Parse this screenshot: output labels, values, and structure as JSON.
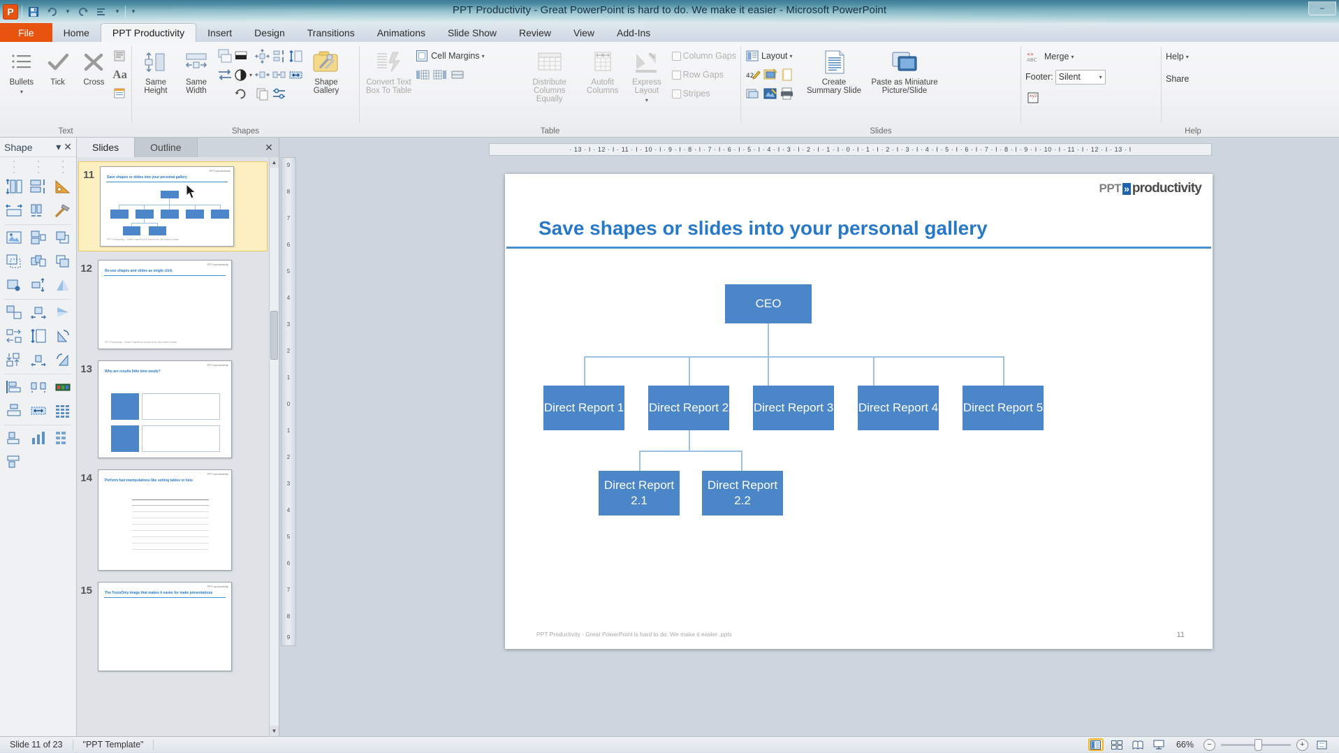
{
  "window": {
    "title": "PPT Productivity - Great PowerPoint is hard to do. We make it easier  -  Microsoft PowerPoint",
    "minimize": "–",
    "maximize": "❐",
    "close": "✕"
  },
  "quick_access": {
    "app_letter": "P",
    "items": [
      {
        "name": "save-icon",
        "glyph": "💾"
      },
      {
        "name": "undo-icon",
        "glyph": "↶"
      },
      {
        "name": "redo-icon",
        "glyph": "↻"
      },
      {
        "name": "align-icon",
        "glyph": "≡"
      },
      {
        "name": "customize-qat-icon",
        "glyph": "▾"
      }
    ]
  },
  "tabs": [
    {
      "label": "File",
      "active": false,
      "file": true
    },
    {
      "label": "Home",
      "active": false
    },
    {
      "label": "PPT Productivity",
      "active": true
    },
    {
      "label": "Insert",
      "active": false
    },
    {
      "label": "Design",
      "active": false
    },
    {
      "label": "Transitions",
      "active": false
    },
    {
      "label": "Animations",
      "active": false
    },
    {
      "label": "Slide Show",
      "active": false
    },
    {
      "label": "Review",
      "active": false
    },
    {
      "label": "View",
      "active": false
    },
    {
      "label": "Add-Ins",
      "active": false
    }
  ],
  "ribbon": {
    "groups": [
      {
        "label": "Text",
        "big_buttons": [
          {
            "label": "Bullets",
            "icon": "bullets-icon",
            "dropdown": true
          },
          {
            "label": "Tick",
            "icon": "tick-icon"
          },
          {
            "label": "Cross",
            "icon": "cross-icon"
          }
        ],
        "small_buttons": [
          {
            "icon": "text-paragraph-icon"
          },
          {
            "icon": "font-aa-icon",
            "glyph": "Aa"
          },
          {
            "icon": "text-box-icon"
          }
        ]
      },
      {
        "label": "Shapes",
        "big_buttons": [
          {
            "label": "Same Height",
            "icon": "same-height-icon"
          },
          {
            "label": "Same Width",
            "icon": "same-width-icon"
          },
          {
            "label": "Shape Gallery",
            "icon": "shape-gallery-icon"
          }
        ],
        "small_buttons": [
          {
            "icon": "align-distribute-horizontal-icon"
          },
          {
            "icon": "align-distribute-vertical-icon"
          },
          {
            "icon": "resize-height-icon"
          },
          {
            "icon": "spread-horizontal-icon"
          },
          {
            "icon": "spread-vertical-icon"
          },
          {
            "icon": "fit-width-icon"
          },
          {
            "icon": "fill-color-icon"
          },
          {
            "icon": "contrast-icon"
          },
          {
            "icon": "rotate-icon"
          },
          {
            "icon": "copy-format-icon"
          },
          {
            "icon": "swap-icon"
          }
        ]
      },
      {
        "label": "Table",
        "big_buttons": [
          {
            "label": "Convert Text Box To Table",
            "icon": "convert-text-to-table-icon",
            "disabled": true
          },
          {
            "label": "Distribute Columns Equally",
            "icon": "distribute-columns-icon",
            "disabled": true
          },
          {
            "label": "Autofit Columns",
            "icon": "autofit-columns-icon",
            "disabled": true
          },
          {
            "label": "Express Layout",
            "icon": "express-layout-icon",
            "disabled": true,
            "dropdown": true
          }
        ],
        "cell_margins_label": "Cell Margins",
        "small_buttons": [
          {
            "icon": "insert-column-left-icon"
          },
          {
            "icon": "insert-column-right-icon"
          },
          {
            "icon": "merge-cells-icon"
          }
        ],
        "checkboxes": [
          {
            "label": "Column Gaps",
            "checked": false
          },
          {
            "label": "Row Gaps",
            "checked": false
          },
          {
            "label": "Stripes",
            "checked": false
          }
        ]
      },
      {
        "label": "Slides",
        "layout_label": "Layout",
        "big_buttons": [
          {
            "label": "Create Summary Slide",
            "icon": "create-summary-slide-icon"
          },
          {
            "label": "Paste as Miniature Picture/Slide",
            "icon": "paste-miniature-icon"
          }
        ],
        "small_buttons": [
          {
            "icon": "rename-slide-icon"
          },
          {
            "icon": "slide-properties-icon"
          },
          {
            "icon": "blank-slide-icon"
          },
          {
            "icon": "slide-export-icon"
          },
          {
            "icon": "slide-image-icon"
          },
          {
            "icon": "print-icon"
          }
        ]
      },
      {
        "label": "Help",
        "merge_label": "Merge",
        "footer_label": "Footer:",
        "footer_value": "Silent",
        "help_label": "Help",
        "share_label": "Share",
        "xyz_icon": "xyz-note-icon"
      }
    ]
  },
  "shape_pane": {
    "title": "Shape",
    "close": "✕",
    "dropdown": "▾",
    "icons": [
      "same-height-icon",
      "align-middle-icon",
      "triangle-ruler-icon",
      "same-width-icon",
      "distribute-horizontal-icon",
      "hammer-icon",
      "insert-picture-icon",
      "duplicate-shape-icon",
      "bring-forward-icon",
      "select-shape-icon",
      "group-shapes-icon",
      "send-backward-icon",
      "picture-fill-icon",
      "spread-vertical-icon",
      "flip-vertical-icon",
      "swap-shapes-icon",
      "spread-horizontal-icon",
      "flip-horizontal-icon",
      "move-right-icon",
      "resize-height-icon",
      "rotate-left-icon",
      "move-down-icon",
      "shrink-horizontal-icon",
      "rotate-right-icon",
      "align-left-icon",
      "expand-horizontal-icon",
      "color-palette-icon",
      "align-center-icon",
      "fit-width-icon",
      "table-grid-icon",
      "align-bottom-icon",
      "chart-icon",
      "matrix-icon",
      "align-top-icon",
      "bar-chart-icon",
      "grid-icon"
    ]
  },
  "slides_pane": {
    "tabs": [
      {
        "label": "Slides",
        "active": true
      },
      {
        "label": "Outline",
        "active": false
      }
    ],
    "close": "✕",
    "thumbnails": [
      {
        "number": "11",
        "title": "Save shapes or slides into your personal gallery",
        "selected": true,
        "type": "orgchart",
        "footer": "PPT Productivity - Great PowerPoint is hard to do. We make it easier"
      },
      {
        "number": "12",
        "title": "Re-use shapes and slides as single click",
        "selected": false,
        "type": "blank",
        "footer": "PPT Productivity - Great PowerPoint is hard to do. We make it easier"
      },
      {
        "number": "13",
        "title": "Who are results little time needs?",
        "selected": false,
        "type": "twobox",
        "footer": ""
      },
      {
        "number": "14",
        "title": "Perform fast manipulations like setting tables or lists",
        "selected": false,
        "type": "table",
        "footer": ""
      },
      {
        "number": "15",
        "title": "The ToolsOnly image that makes it easier for make presentations",
        "selected": false,
        "type": "blank",
        "footer": ""
      }
    ]
  },
  "ruler": {
    "horizontal": "· 13 · I · 12 · I · 11 · I · 10 · I · 9 · I · 8 · I · 7 · I · 6 · I · 5 · I · 4 · I · 3 · I · 2 · I · 1 · I · 0 · I · 1 · I · 2 · I · 3 · I · 4 · I · 5 · I · 6 · I · 7 · I · 8 · I · 9 · I · 10 · I · 11 · I · 12 · I · 13 · I",
    "vertical_ticks": [
      "9",
      "8",
      "7",
      "6",
      "5",
      "4",
      "3",
      "2",
      "1",
      "0",
      "1",
      "2",
      "3",
      "4",
      "5",
      "6",
      "7",
      "8",
      "9"
    ]
  },
  "slide": {
    "logo": {
      "ppt": "PPT",
      "chevron": "»",
      "productivity": "productivity"
    },
    "title": "Save shapes or slides into your personal gallery",
    "footer": "PPT Productivity - Great PowerPoint  is hard  to do. We make it easier .pptx",
    "number": "11",
    "chart_data": {
      "type": "orgchart",
      "title": "Save shapes or slides into your personal gallery",
      "nodes": [
        {
          "id": "ceo",
          "label": "CEO",
          "level": 0,
          "parent": null
        },
        {
          "id": "dr1",
          "label": "Direct Report 1",
          "level": 1,
          "parent": "ceo"
        },
        {
          "id": "dr2",
          "label": "Direct Report 2",
          "level": 1,
          "parent": "ceo"
        },
        {
          "id": "dr3",
          "label": "Direct Report 3",
          "level": 1,
          "parent": "ceo"
        },
        {
          "id": "dr4",
          "label": "Direct Report 4",
          "level": 1,
          "parent": "ceo"
        },
        {
          "id": "dr5",
          "label": "Direct Report 5",
          "level": 1,
          "parent": "ceo"
        },
        {
          "id": "dr21",
          "label": "Direct Report 2.1",
          "level": 2,
          "parent": "dr2"
        },
        {
          "id": "dr22",
          "label": "Direct Report 2.2",
          "level": 2,
          "parent": "dr2"
        }
      ],
      "node_fill": "#4a86c8",
      "connector_color": "#9cc0e2",
      "text_color": "#ffffff"
    }
  },
  "statusbar": {
    "slide_counter": "Slide 11 of 23",
    "template": "\"PPT Template\"",
    "zoom": "66%",
    "zoom_out": "−",
    "zoom_in": "+",
    "views": [
      {
        "name": "normal-view-button",
        "active": true
      },
      {
        "name": "slide-sorter-view-button",
        "active": false
      },
      {
        "name": "reading-view-button",
        "active": false
      },
      {
        "name": "slide-show-button",
        "active": false
      }
    ],
    "fit_window": "fit-to-window-icon"
  }
}
